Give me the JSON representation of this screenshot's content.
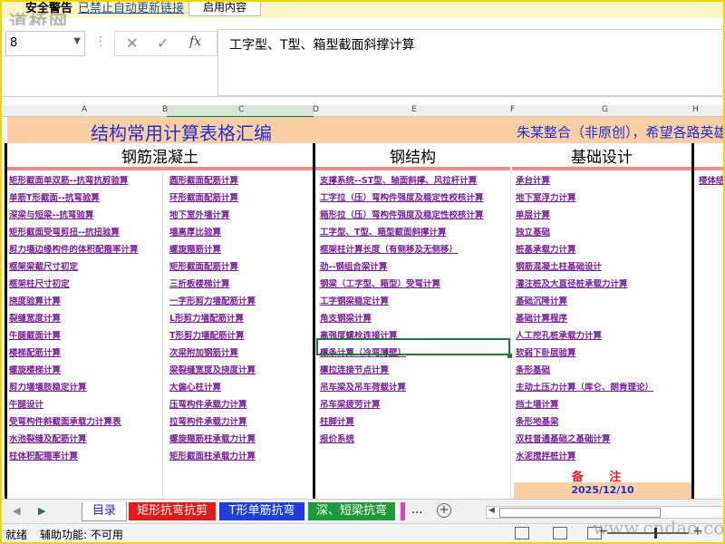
{
  "security_bar": {
    "title": "安全警告",
    "message": "已禁止自动更新链接",
    "button": "启用内容"
  },
  "watermark_top": "道桥网",
  "formula_bar": {
    "name_box": "8",
    "fx_label": "fx",
    "content": "工字型、T型、箱型截面斜撑计算"
  },
  "columns": [
    {
      "letter": "A"
    },
    {
      "letter": "B"
    },
    {
      "letter": "C"
    },
    {
      "letter": "D"
    },
    {
      "letter": "E"
    },
    {
      "letter": "F"
    },
    {
      "letter": "G"
    },
    {
      "letter": "H"
    }
  ],
  "sheet": {
    "title": "结构常用计算表格汇编",
    "note": "朱某整合（非原创），希望各路英雄",
    "categories": {
      "concrete": "钢筋混凝土",
      "steel": "钢结构",
      "foundation": "基础设计"
    },
    "concrete_col1": [
      "矩形截面单双筋--抗弯抗剪验算",
      "单筋T形截面--抗弯验算",
      "深梁与短梁--抗弯验算",
      "矩形截面受弯剪扭--抗扭验算",
      "剪力墙边缘构件的体积配箍率计算",
      "框架梁截尺寸初定",
      "框架柱尺寸初定",
      "挠度验算计算",
      "裂缝宽度计算",
      "牛腿截面计算",
      "楼梯配筋计算",
      "螺旋楼梯计算",
      "剪力墙墙肢稳定计算",
      "牛腿设计",
      "受弯构件斜截面承载力计算表",
      "水池裂缝及配筋计算",
      "柱体积配箍率计算"
    ],
    "concrete_col2": [
      "圆形截面配筋计算",
      "环形截面配筋计算",
      "地下室外墙计算",
      "墙高厚比验算",
      "螺旋箍筋计算",
      "矩形截面配筋计算",
      "三折板楼梯计算",
      "一字形剪力墙配筋计算",
      "L形剪力墙配筋计算",
      "T形剪力墙配筋计算",
      "次梁附加钢筋计算",
      "梁裂缝宽度及挠度计算",
      "大偏心柱计算",
      "压弯构件承载力计算",
      "拉弯构件承载力计算",
      "螺旋箍筋柱承载力计算",
      "矩形截面柱承载力计算"
    ],
    "steel": [
      "支撑系统--ST型、轴面斜撑、风拉杆计算",
      "工字拉（压）弯构件强度及稳定性校核计算",
      "箱形拉（压）弯构件强度及稳定性校核计算",
      "工字型、T型、箱型截面斜撑计算",
      "框架柱计算长度（有侧移及无侧移）",
      "劲--钢组合梁计算",
      "钢梁（工字型、箱型）受弯计算",
      "工字钢梁稳定计算",
      "角支钢梁计算",
      "高强度螺栓连接计算",
      "檩条计算（冷弯薄壁）",
      "檩拉连接节点计算",
      "吊车梁及吊车荷载计算",
      "吊车梁疲劳计算",
      "柱脚计算",
      "报价系统"
    ],
    "foundation": [
      "承台计算",
      "地下室浮力计算",
      "单层计算",
      "独立基础",
      "桩基承载力计算",
      "钢筋混凝土柱基础设计",
      "灌注桩及大直径桩承载力计算",
      "基础沉降计算",
      "基础计算程序",
      "人工挖孔桩承载力计算",
      "软弱下卧层验算",
      "条形基础",
      "主动土压力计算（库仑、朗肯理论）",
      "挡土墙计算",
      "条形地基梁",
      "双柱普通基础之基础计算",
      "水泥搅拌桩计算"
    ],
    "extra_col": [
      "楼体结"
    ],
    "remark_label": "备 注",
    "date": "2025/12/10"
  },
  "sheet_tabs": [
    {
      "label": "目录",
      "bg": "#ffffff",
      "color": "#1f2fd8"
    },
    {
      "label": "矩形抗弯抗剪",
      "bg": "#e01b1b",
      "color": "#ffffff"
    },
    {
      "label": "T形单筋抗弯",
      "bg": "#1e3de0",
      "color": "#ffffff"
    },
    {
      "label": "深、短梁抗弯",
      "bg": "#1f9a3a",
      "color": "#ffffff"
    }
  ],
  "tabs_more": "...",
  "status_bar": {
    "ready": "就绪",
    "accessibility": "辅助功能: 不可用"
  },
  "watermark_bottom": "www.cndao.com",
  "colors": {
    "title_bg": "#fbcfa4",
    "title_text": "#1f2fd8",
    "link": "#7a1f9a",
    "divider": "#f28a8a",
    "selection": "#1d7a3c",
    "frame": "#f4d400"
  }
}
